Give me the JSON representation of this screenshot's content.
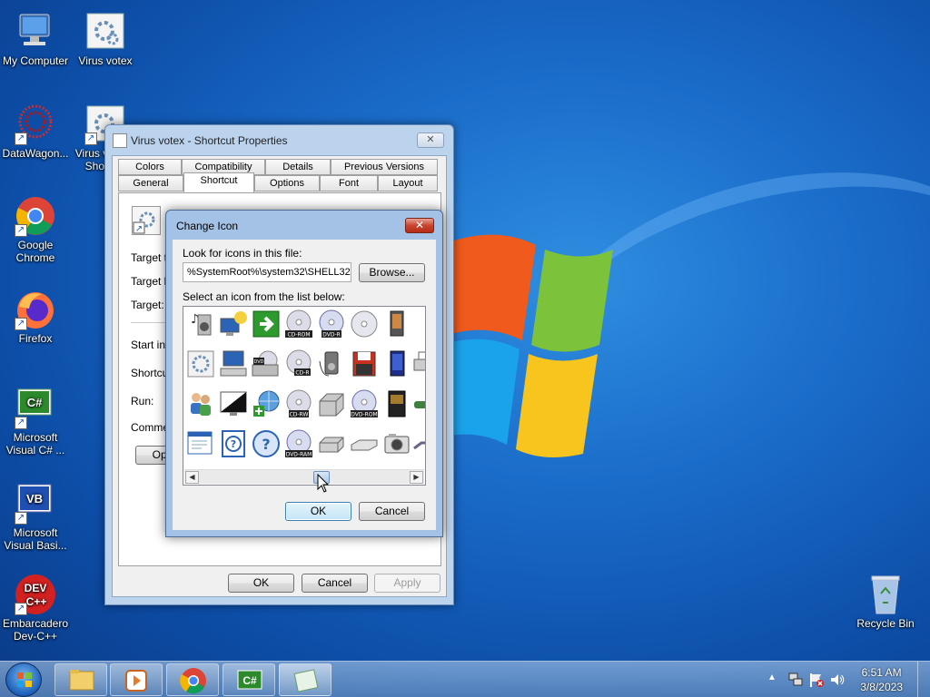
{
  "desktop": {
    "icons": [
      {
        "label": "My Computer"
      },
      {
        "label": "Virus votex"
      },
      {
        "label": "DataWagon..."
      },
      {
        "label": "Virus votex - Shortcut"
      },
      {
        "label": "Google Chrome"
      },
      {
        "label": "Firefox"
      },
      {
        "label": "Microsoft Visual C# ..."
      },
      {
        "label": "Microsoft Visual Basi..."
      },
      {
        "label": "Embarcadero Dev-C++"
      },
      {
        "label": "Recycle Bin"
      }
    ]
  },
  "properties_window": {
    "title": "Virus votex - Shortcut Properties",
    "tabs_row1": [
      "Colors",
      "Compatibility",
      "Details",
      "Previous Versions"
    ],
    "tabs_row2": [
      "General",
      "Shortcut",
      "Options",
      "Font",
      "Layout"
    ],
    "active_tab": "Shortcut",
    "field_labels": [
      "Target t",
      "Target lo",
      "Target:",
      "Start in:",
      "Shortcut",
      "Run:",
      "Commen"
    ],
    "open_button": "Ope",
    "ok": "OK",
    "cancel": "Cancel",
    "apply": "Apply"
  },
  "change_icon_dialog": {
    "title": "Change Icon",
    "close": "✕",
    "look_label": "Look for icons in this file:",
    "file_path": "%SystemRoot%\\system32\\SHELL32",
    "browse": "Browse...",
    "select_label": "Select an icon from the list below:",
    "ok": "OK",
    "cancel": "Cancel",
    "icon_badges": [
      "CD-ROM",
      "DVD-R",
      "DVD",
      "CD-R",
      "CD-RW",
      "DVD-ROM",
      "DVD-RAM"
    ]
  },
  "taskbar": {
    "time": "6:51 AM",
    "date": "3/8/2023",
    "csharp_badge": "C#"
  }
}
